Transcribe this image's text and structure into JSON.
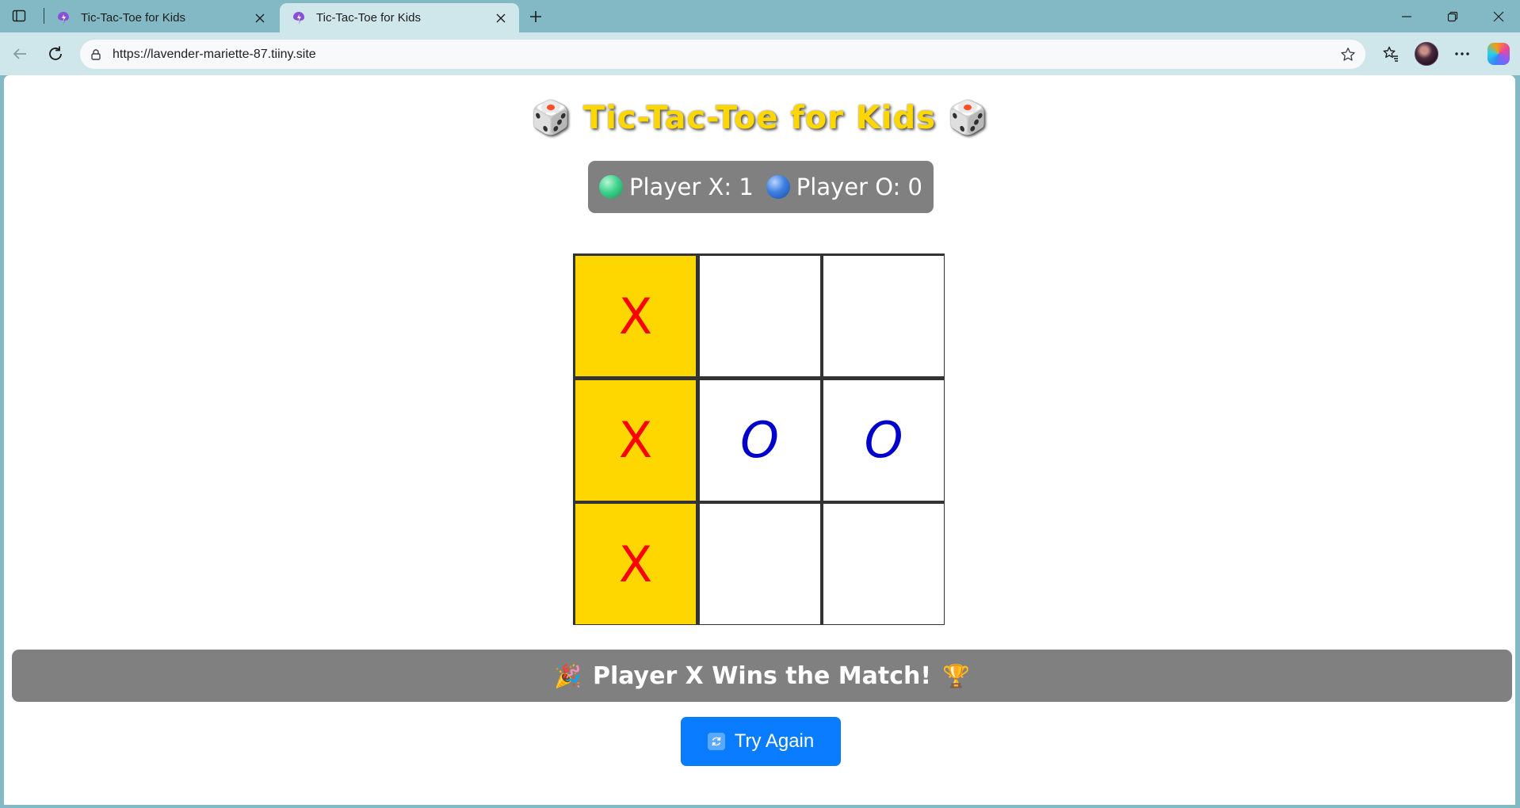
{
  "browser": {
    "tabs": [
      {
        "title": "Tic-Tac-Toe for Kids",
        "active": false
      },
      {
        "title": "Tic-Tac-Toe for Kids",
        "active": true
      }
    ],
    "url": "https://lavender-mariette-87.tiiny.site"
  },
  "game": {
    "title": "Tic-Tac-Toe for Kids",
    "title_emoji": "🎲",
    "score": {
      "x_label": "Player X: 1",
      "o_label": "Player O: 0"
    },
    "board": [
      {
        "mark": "X",
        "win": true
      },
      {
        "mark": "",
        "win": false
      },
      {
        "mark": "",
        "win": false
      },
      {
        "mark": "X",
        "win": true
      },
      {
        "mark": "O",
        "win": false
      },
      {
        "mark": "O",
        "win": false
      },
      {
        "mark": "X",
        "win": true
      },
      {
        "mark": "",
        "win": false
      },
      {
        "mark": "",
        "win": false
      }
    ],
    "message": "Player X Wins the Match!",
    "message_emoji_left": "🎉",
    "message_emoji_right": "🏆",
    "reset_label": "Try Again"
  },
  "colors": {
    "win_cell": "#ffd700",
    "x_mark": "#ff0000",
    "o_mark": "#0000cd",
    "button": "#0a7cff",
    "panel": "#808080"
  }
}
